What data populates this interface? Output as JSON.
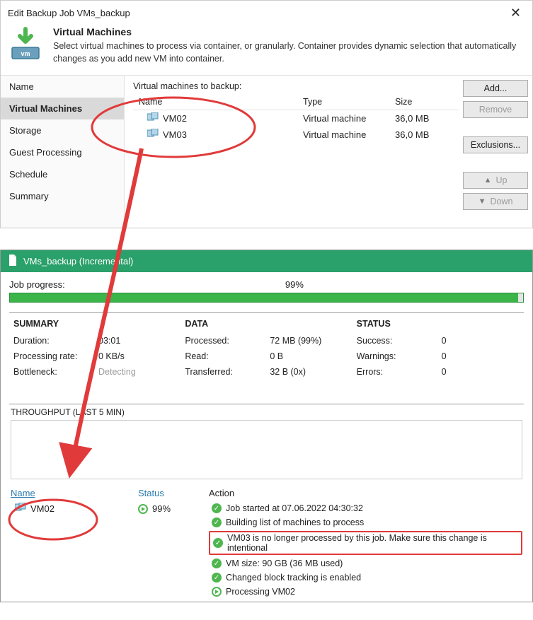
{
  "dialog": {
    "title": "Edit Backup Job VMs_backup",
    "heading": "Virtual Machines",
    "subtext": "Select virtual machines to process via container, or granularly. Container provides dynamic selection that automatically changes as you add new VM into container.",
    "nav": [
      {
        "label": "Name",
        "selected": false
      },
      {
        "label": "Virtual Machines",
        "selected": true
      },
      {
        "label": "Storage",
        "selected": false
      },
      {
        "label": "Guest Processing",
        "selected": false
      },
      {
        "label": "Schedule",
        "selected": false
      },
      {
        "label": "Summary",
        "selected": false
      }
    ],
    "vms_label": "Virtual machines to backup:",
    "columns": {
      "name": "Name",
      "type": "Type",
      "size": "Size"
    },
    "rows": [
      {
        "name": "VM02",
        "type": "Virtual machine",
        "size": "36,0 MB"
      },
      {
        "name": "VM03",
        "type": "Virtual machine",
        "size": "36,0 MB"
      }
    ],
    "buttons": {
      "add": "Add...",
      "remove": "Remove",
      "exclusions": "Exclusions...",
      "up": "Up",
      "down": "Down"
    }
  },
  "job": {
    "title": "VMs_backup (Incremental)",
    "progress_label": "Job progress:",
    "progress_value": "99%",
    "sections": {
      "summary": {
        "head": "SUMMARY",
        "items": [
          {
            "k": "Duration:",
            "v": "03:01"
          },
          {
            "k": "Processing rate:",
            "v": "0 KB/s"
          },
          {
            "k": "Bottleneck:",
            "v": "Detecting",
            "muted": true
          }
        ]
      },
      "data": {
        "head": "DATA",
        "items": [
          {
            "k": "Processed:",
            "v": "72 MB (99%)"
          },
          {
            "k": "Read:",
            "v": "0 B"
          },
          {
            "k": "Transferred:",
            "v": "32 B (0x)"
          }
        ]
      },
      "status": {
        "head": "STATUS",
        "items": [
          {
            "k": "Success:",
            "v": "0"
          },
          {
            "k": "Warnings:",
            "v": "0"
          },
          {
            "k": "Errors:",
            "v": "0"
          }
        ]
      }
    },
    "throughput_label": "THROUGHPUT (LAST 5 MIN)",
    "bottom": {
      "name_head": "Name",
      "status_head": "Status",
      "action_head": "Action",
      "vm_name": "VM02",
      "vm_status": "99%",
      "actions": [
        {
          "icon": "ok",
          "text": "Job started at 07.06.2022 04:30:32"
        },
        {
          "icon": "ok",
          "text": "Building list of machines to process"
        },
        {
          "icon": "ok",
          "text": "VM03 is no longer processed by this job. Make sure this change is intentional",
          "hl": true
        },
        {
          "icon": "ok",
          "text": "VM size: 90 GB (36 MB used)"
        },
        {
          "icon": "ok",
          "text": "Changed block tracking is enabled"
        },
        {
          "icon": "play",
          "text": "Processing VM02"
        }
      ]
    }
  }
}
